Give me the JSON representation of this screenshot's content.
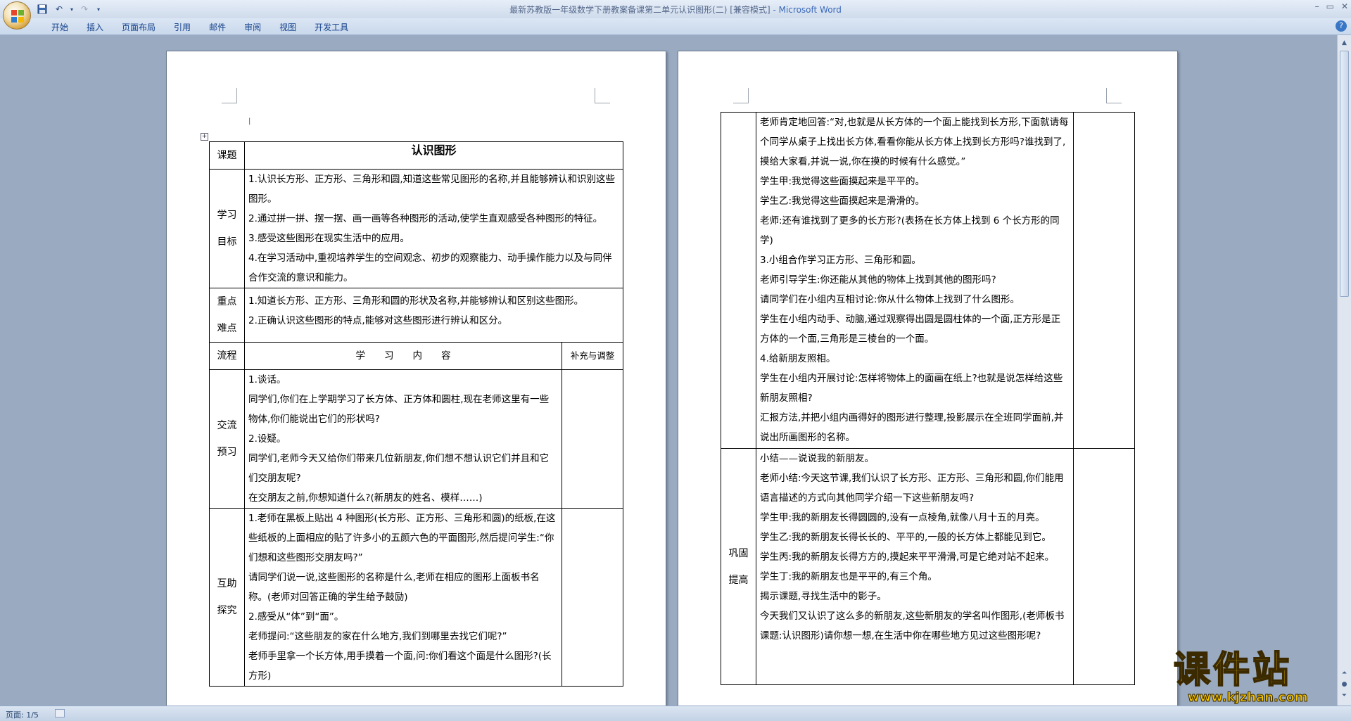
{
  "titlebar": {
    "doc_name": "最新苏教版一年级数学下册教案备课第二单元认识图形(二) [兼容模式]",
    "app_name": " - Microsoft Word"
  },
  "ribbon": {
    "tabs": [
      "开始",
      "插入",
      "页面布局",
      "引用",
      "邮件",
      "审阅",
      "视图",
      "开发工具"
    ]
  },
  "status": {
    "page": "页面: 1/5"
  },
  "page1": {
    "title": "认识图形",
    "label_topic": "课题",
    "goal_label": [
      "学习",
      "目标"
    ],
    "goals": [
      "1.认识长方形、正方形、三角形和圆,知道这些常见图形的名称,并且能够辨认和识别这些图形。",
      "2.通过拼一拼、摆一摆、画一画等各种图形的活动,使学生直观感受各种图形的特征。",
      "3.感受这些图形在现实生活中的应用。",
      "4.在学习活动中,重视培养学生的空间观念、初步的观察能力、动手操作能力以及与同伴合作交流的意识和能力。"
    ],
    "key_label": [
      "重点",
      "难点"
    ],
    "keys": [
      "1.知道长方形、正方形、三角形和圆的形状及名称,并能够辨认和区别这些图形。",
      "2.正确认识这些图形的特点,能够对这些图形进行辨认和区分。"
    ],
    "flow_header": {
      "col1": "流程",
      "col2": "学　　习　　内　　容",
      "col3": "补充与调整"
    },
    "section1_label": [
      "交流",
      "预习"
    ],
    "section1": [
      "1.谈话。",
      "同学们,你们在上学期学习了长方体、正方体和圆柱,现在老师这里有一些物体,你们能说出它们的形状吗?",
      "2.设疑。",
      "同学们,老师今天又给你们带来几位新朋友,你们想不想认识它们并且和它们交朋友呢?",
      "在交朋友之前,你想知道什么?(新朋友的姓名、模样……)"
    ],
    "section2_label": [
      "互助",
      "探究"
    ],
    "section2": [
      "1.老师在黑板上贴出 4 种图形(长方形、正方形、三角形和圆)的纸板,在这些纸板的上面相应的贴了许多小的五颜六色的平面图形,然后提问学生:“你们想和这些图形交朋友吗?”",
      "请同学们说一说,这些图形的名称是什么,老师在相应的图形上面板书名称。(老师对回答正确的学生给予鼓励)",
      "2.感受从“体”到“面”。",
      "老师提问:“这些朋友的家在什么地方,我们到哪里去找它们呢?”",
      "老师手里拿一个长方体,用手摸着一个面,问:你们看这个面是什么图形?(长方形)"
    ]
  },
  "page2": {
    "block1": [
      "老师肯定地回答:“对,也就是从长方体的一个面上能找到长方形,下面就请每个同学从桌子上找出长方体,看看你能从长方体上找到长方形吗?谁找到了,摸给大家看,并说一说,你在摸的时候有什么感觉。”",
      "学生甲:我觉得这些面摸起来是平平的。",
      "学生乙:我觉得这些面摸起来是滑滑的。",
      "老师:还有谁找到了更多的长方形?(表扬在长方体上找到 6 个长方形的同学)",
      "3.小组合作学习正方形、三角形和圆。",
      "老师引导学生:你还能从其他的物体上找到其他的图形吗?",
      "请同学们在小组内互相讨论:你从什么物体上找到了什么图形。",
      "学生在小组内动手、动脑,通过观察得出圆是圆柱体的一个面,正方形是正方体的一个面,三角形是三棱台的一个面。",
      "4.给新朋友照相。",
      "学生在小组内开展讨论:怎样将物体上的面画在纸上?也就是说怎样给这些新朋友照相?",
      "汇报方法,并把小组内画得好的图形进行整理,投影展示在全班同学面前,并说出所画图形的名称。"
    ],
    "section3_label": [
      "巩固",
      "提高"
    ],
    "block2": [
      "小结——说说我的新朋友。",
      "老师小结:今天这节课,我们认识了长方形、正方形、三角形和圆,你们能用语言描述的方式向其他同学介绍一下这些新朋友吗?",
      "学生甲:我的新朋友长得圆圆的,没有一点棱角,就像八月十五的月亮。",
      "学生乙:我的新朋友长得长长的、平平的,一般的长方体上都能见到它。",
      "学生丙:我的新朋友长得方方的,摸起来平平滑滑,可是它绝对站不起来。",
      "学生丁:我的新朋友也是平平的,有三个角。",
      "揭示课题,寻找生活中的影子。",
      "今天我们又认识了这么多的新朋友,这些新朋友的学名叫作图形,(老师板书课题:认识图形)请你想一想,在生活中你在哪些地方见过这些图形呢?"
    ]
  },
  "watermark": {
    "cn": "课件站",
    "url": "www.kjzhan.com"
  },
  "icons": {
    "office": "office-button-icon",
    "save": "save-icon",
    "undo": "undo-icon",
    "redo": "redo-icon",
    "help": "help-icon"
  }
}
